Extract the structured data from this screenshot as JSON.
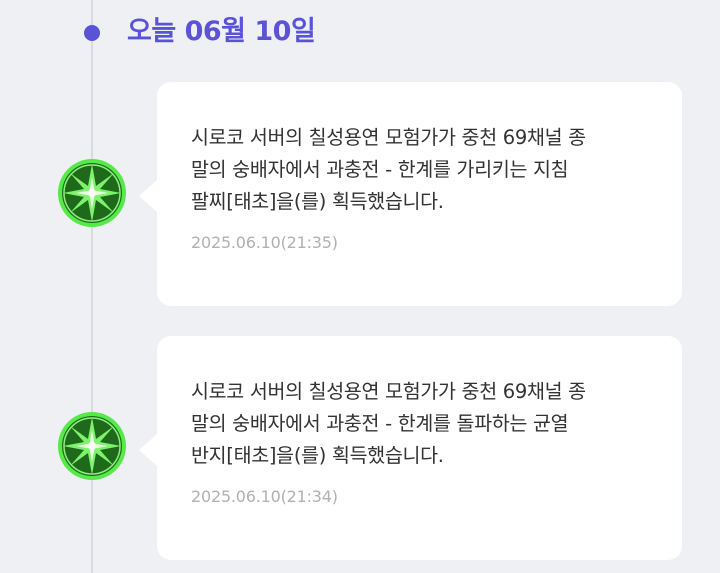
{
  "date_header": "오늘 06월 10일",
  "items": [
    {
      "icon": "green-starburst-item-icon",
      "message": "시로코 서버의 칠성용연 모험가가 중천 69채널 종\n말의 숭배자에서 과충전 - 한계를 가리키는 지침\n팔찌[태초]을(를) 획득했습니다.",
      "time": "2025.06.10(21:35)"
    },
    {
      "icon": "green-starburst-item-icon",
      "message": "시로코 서버의 칠성용연 모험가가 중천 69채널 종\n말의 숭배자에서 과충전 - 한계를 돌파하는 균열\n반지[태초]을(를) 획득했습니다.",
      "time": "2025.06.10(21:34)"
    }
  ],
  "colors": {
    "accent": "#5b53d6",
    "background": "#eff0f4",
    "card": "#ffffff",
    "icon_green": "#57e84a",
    "timestamp": "#b0b0b5"
  }
}
